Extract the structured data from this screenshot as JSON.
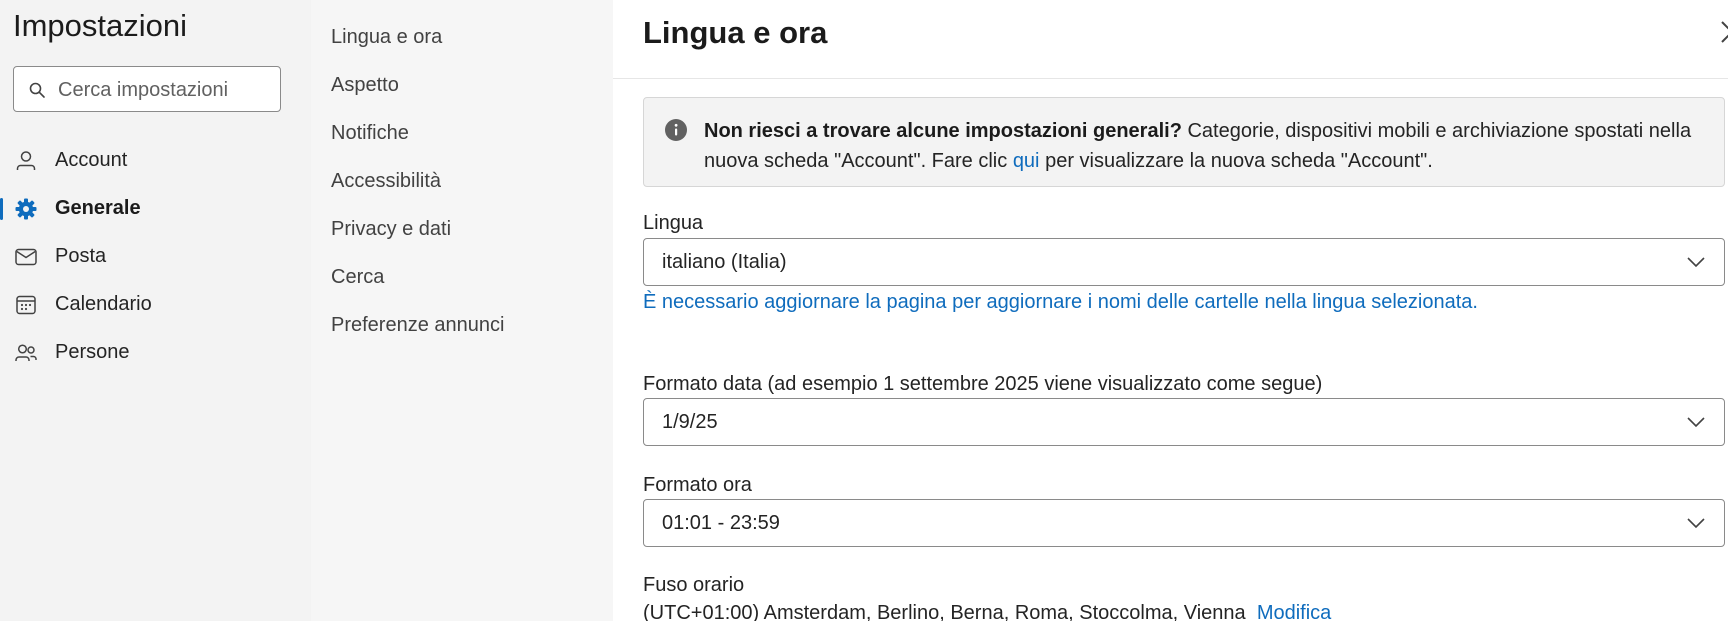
{
  "app": {
    "title": "Impostazioni",
    "search_placeholder": "Cerca impostazioni"
  },
  "nav": {
    "items": [
      {
        "label": "Account",
        "icon": "person-icon"
      },
      {
        "label": "Generale",
        "icon": "gear-icon",
        "selected": true
      },
      {
        "label": "Posta",
        "icon": "mail-icon"
      },
      {
        "label": "Calendario",
        "icon": "calendar-icon"
      },
      {
        "label": "Persone",
        "icon": "people-icon"
      }
    ]
  },
  "subnav": {
    "items": [
      {
        "label": "Lingua e ora"
      },
      {
        "label": "Aspetto"
      },
      {
        "label": "Notifiche"
      },
      {
        "label": "Accessibilità"
      },
      {
        "label": "Privacy e dati"
      },
      {
        "label": "Cerca"
      },
      {
        "label": "Preferenze annunci"
      }
    ]
  },
  "main": {
    "title": "Lingua e ora",
    "banner": {
      "bold": "Non riesci a trovare alcune impostazioni generali?",
      "text1": " Categorie, dispositivi mobili e archiviazione spostati nella nuova scheda \"Account\". Fare clic ",
      "link": "qui",
      "text2": " per visualizzare la nuova scheda \"Account\"."
    },
    "language": {
      "label": "Lingua",
      "value": "italiano (Italia)",
      "hint": "È necessario aggiornare la pagina per aggiornare i nomi delle cartelle nella lingua selezionata."
    },
    "date_format": {
      "label": "Formato data (ad esempio 1 settembre 2025 viene visualizzato come segue)",
      "value": "1/9/25"
    },
    "time_format": {
      "label": "Formato ora",
      "value": "01:01 - 23:59"
    },
    "timezone": {
      "label": "Fuso orario",
      "value": "(UTC+01:00) Amsterdam, Berlino, Berna, Roma, Stoccolma, Vienna",
      "link": "Modifica"
    }
  },
  "colors": {
    "accent": "#0f6cbd",
    "sidebar_bg": "#f3f3f3",
    "subnav_bg": "#f6f6f6",
    "banner_bg": "#f3f3f3"
  }
}
